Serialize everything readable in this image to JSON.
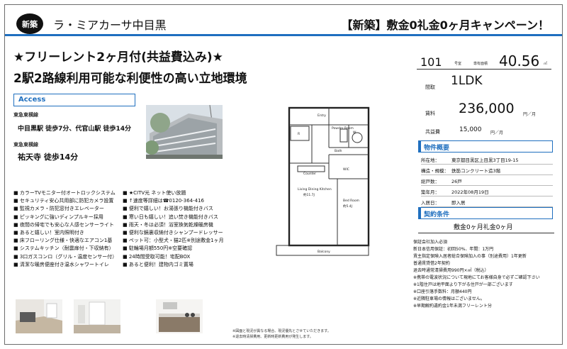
{
  "header": {
    "badge": "新築",
    "property_name": "ラ・ミアカーサ中目黒",
    "campaign": "【新築】敷金0礼金0ヶ月キャンペーン！",
    "accent_color": "#1f6fbf"
  },
  "headlines": {
    "line1": "★フリーレント2ヶ月付(共益費込み)★",
    "line2": "2駅2路線利用可能な利便性の高い立地環境"
  },
  "access": {
    "title": "Access",
    "line1_name": "東急東横線",
    "line1_stations": "中目黒駅 徒歩7分、代官山駅 徒歩14分",
    "line2_name": "東急東横線",
    "line2_stations": "祐天寺 徒歩14分"
  },
  "features": {
    "left": [
      "カラーTVモニター付オートロックシステム",
      "セキュリティ安心共用部に防犯カメラ設置",
      "監視カメラ・防犯窓付きエレベーター",
      "ピッキングに強いディンプルキー採用",
      "夜間の帰宅でも安心な人感センサーライト",
      "あると嬉しい！室内照明付き",
      "床フローリング仕様・快適なエアコン1基",
      "システムキッチン（耐震扉付・下収納有）",
      "3口ガスコンロ（グリル・温度センサー付）",
      "清潔な暖房便座付き温水シャワートイレ"
    ],
    "right": [
      "★CITV光 ネット使い放題",
      "↑速度等詳細は☎0120-364-416",
      "便利で嬉しい！お湯張り機能付きバス",
      "寒い日も嬉しい！追い焚き機能付きバス",
      "雨天・冬は必須！浴室換気乾燥暖房機",
      "便利な鏡裏収納付きシャンプードレッサー",
      "ペット可：小型犬・猫2匹※別途敷金1ヶ月",
      "駐輪場月額550円※空要確認",
      "24時間受取可能！宅配BOX",
      "あると便利！建物内ゴミ置場"
    ]
  },
  "floorplan": {
    "labels": {
      "entry": "Entry",
      "powder": "Powder Room",
      "w": "W",
      "r": "R",
      "bath": "Bath",
      "counter": "Counter",
      "wic": "WIC",
      "ldk": "Living Dining Kitchen",
      "ldk_size": "約11.7J",
      "bed": "Bed Room",
      "bed_size": "約5.4J",
      "balcony": "Balcony"
    },
    "note1": "※図面と現況が異なる場合、現況優先とさせていただきます。",
    "note2": "※退去時清掃費用、更新時更新費用が発生します。"
  },
  "room": {
    "number": "101",
    "number_label": "号室",
    "area_label": "専有面積",
    "area": "40.56",
    "area_unit": "㎡",
    "layout_label": "間取",
    "layout": "1LDK",
    "rent_label": "賃料",
    "rent": "236,000",
    "rent_unit": "円／月",
    "fee_label": "共益費",
    "fee": "15,000",
    "fee_unit": "円／月"
  },
  "overview": {
    "title": "物件概要",
    "rows": [
      {
        "k": "所在地：",
        "v": "東京都目黒区上目黒3丁目19-15"
      },
      {
        "k": "構造・規模：",
        "v": "鉄筋コンクリート造3階"
      },
      {
        "k": "総戸数：",
        "v": "26戸"
      },
      {
        "k": "築年月：",
        "v": "2022年08月19日"
      },
      {
        "k": "入居日：",
        "v": "即入居"
      }
    ]
  },
  "conditions": {
    "title": "契約条件",
    "main": "敷金0ヶ月礼金0ヶ月",
    "notes": [
      "保証会社加入必須",
      "新日本信用保証：初回50%、年間：1万円",
      "賃主指定保険入居者総合保険加入の事（別途費用）1年更新",
      "普通賃貸借2年契約",
      "退去時通常清掃費用990円×㎡（税込）",
      "※携帯の電波状況について現地にてお客様自身で必ずご確認下さい",
      "※1階住戸は地平面より下がる住戸が一部ございます",
      "※口座引落手数料：月額440円",
      "※近隣駐車場の情報はございません。",
      "※早期解約違約金1年未満フリーレント分"
    ]
  }
}
